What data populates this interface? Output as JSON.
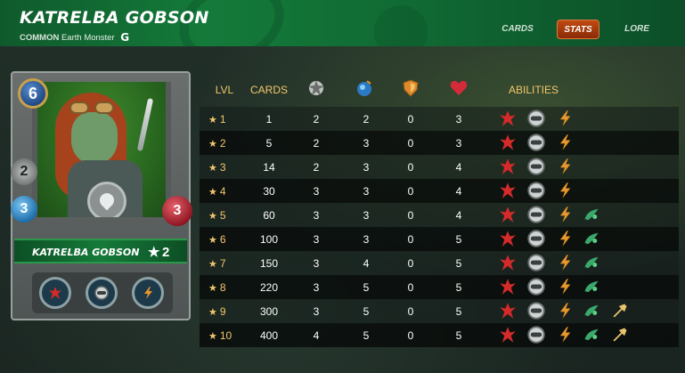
{
  "header": {
    "title": "KATRELBA GOBSON",
    "rarity": "COMMON",
    "type": "Earth Monster",
    "edition_mark": "G",
    "tabs": [
      {
        "label": "CARDS",
        "active": false
      },
      {
        "label": "STATS",
        "active": true
      },
      {
        "label": "LORE",
        "active": false
      }
    ]
  },
  "card": {
    "name": "KATRELBA GOBSON",
    "mana": "6",
    "melee": "2",
    "ranged": "3",
    "health": "3",
    "star": "★",
    "level": "2",
    "abilities": [
      "enrage-icon",
      "shield-icon",
      "rush-icon"
    ]
  },
  "table": {
    "headers": {
      "lvl": "LVL",
      "cards": "CARDS",
      "melee": "melee-attack-icon",
      "ranged": "ranged-attack-icon",
      "armor": "armor-icon",
      "health": "health-icon",
      "abilities": "ABILITIES"
    },
    "star": "★",
    "rows": [
      {
        "lvl": "1",
        "cards": "1",
        "melee": "2",
        "ranged": "2",
        "armor": "0",
        "health": "3",
        "abilities": [
          "enrage",
          "shield",
          "rush"
        ]
      },
      {
        "lvl": "2",
        "cards": "5",
        "melee": "2",
        "ranged": "3",
        "armor": "0",
        "health": "3",
        "abilities": [
          "enrage",
          "shield",
          "rush"
        ]
      },
      {
        "lvl": "3",
        "cards": "14",
        "melee": "2",
        "ranged": "3",
        "armor": "0",
        "health": "4",
        "abilities": [
          "enrage",
          "shield",
          "rush"
        ]
      },
      {
        "lvl": "4",
        "cards": "30",
        "melee": "3",
        "ranged": "3",
        "armor": "0",
        "health": "4",
        "abilities": [
          "enrage",
          "shield",
          "rush"
        ]
      },
      {
        "lvl": "5",
        "cards": "60",
        "melee": "3",
        "ranged": "3",
        "armor": "0",
        "health": "4",
        "abilities": [
          "enrage",
          "shield",
          "rush",
          "poison"
        ]
      },
      {
        "lvl": "6",
        "cards": "100",
        "melee": "3",
        "ranged": "3",
        "armor": "0",
        "health": "5",
        "abilities": [
          "enrage",
          "shield",
          "rush",
          "poison"
        ]
      },
      {
        "lvl": "7",
        "cards": "150",
        "melee": "3",
        "ranged": "4",
        "armor": "0",
        "health": "5",
        "abilities": [
          "enrage",
          "shield",
          "rush",
          "poison"
        ]
      },
      {
        "lvl": "8",
        "cards": "220",
        "melee": "3",
        "ranged": "5",
        "armor": "0",
        "health": "5",
        "abilities": [
          "enrage",
          "shield",
          "rush",
          "poison"
        ]
      },
      {
        "lvl": "9",
        "cards": "300",
        "melee": "3",
        "ranged": "5",
        "armor": "0",
        "health": "5",
        "abilities": [
          "enrage",
          "shield",
          "rush",
          "poison",
          "trample"
        ]
      },
      {
        "lvl": "10",
        "cards": "400",
        "melee": "4",
        "ranged": "5",
        "armor": "0",
        "health": "5",
        "abilities": [
          "enrage",
          "shield",
          "rush",
          "poison",
          "trample"
        ]
      }
    ]
  },
  "colors": {
    "accent": "#f2c76a",
    "header_green": "#147a3a",
    "active_tab": "#c04a12"
  }
}
